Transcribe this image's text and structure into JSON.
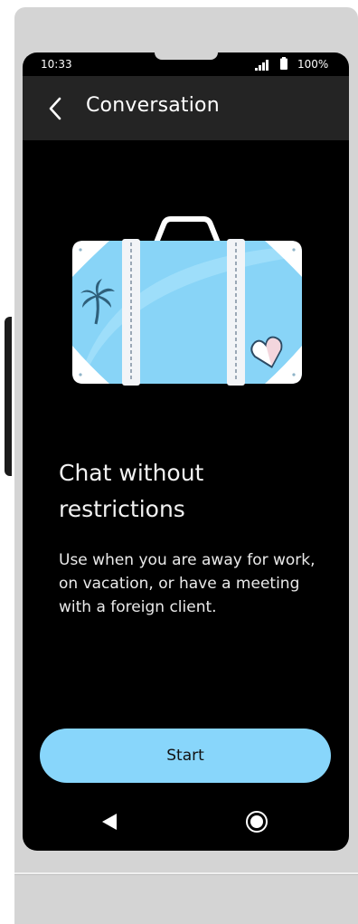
{
  "status_bar": {
    "time": "10:33",
    "battery": "100%"
  },
  "app_bar": {
    "title": "Conversation"
  },
  "content": {
    "headline": "Chat without restrictions",
    "description": "Use when you are away for work, on vacation, or have a meeting with a foreign client."
  },
  "actions": {
    "start_label": "Start"
  },
  "icons": [
    "back-arrow-icon",
    "signal-icon",
    "battery-icon",
    "suitcase-illustration",
    "nav-back-icon",
    "nav-home-icon"
  ],
  "colors": {
    "accent": "#88d6fb",
    "app_bar": "#242424",
    "screen_bg": "#000000"
  }
}
